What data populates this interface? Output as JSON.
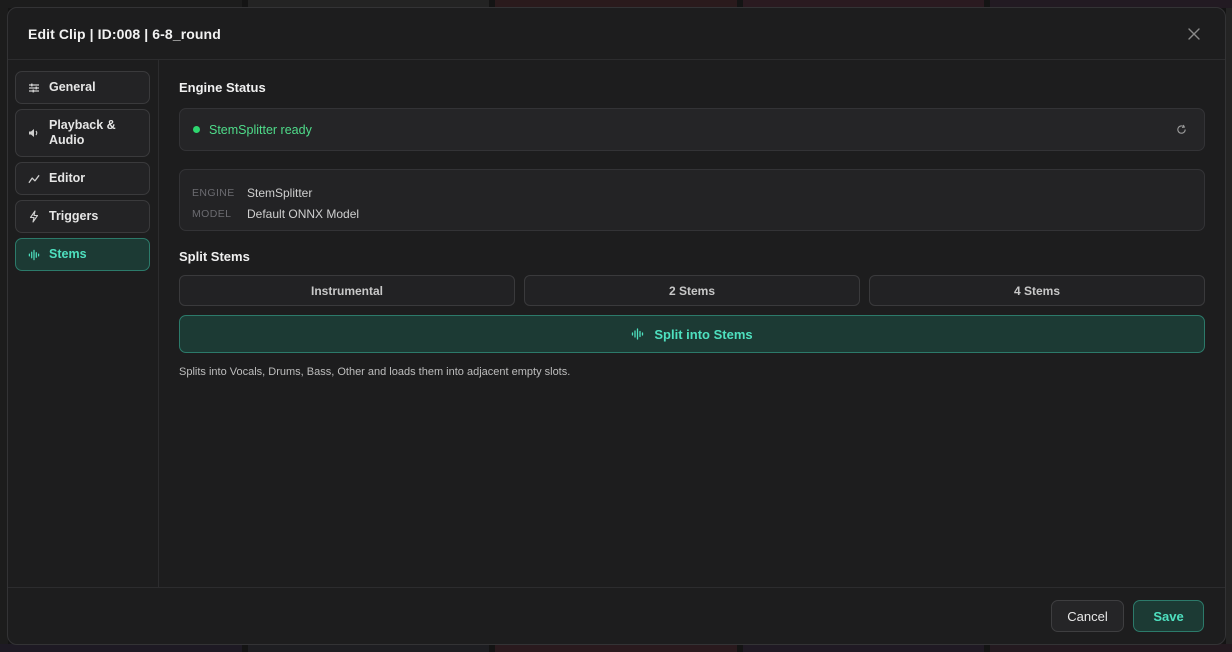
{
  "window": {
    "title": "Edit Clip | ID:008 | 6-8_round",
    "close_icon": "close-icon"
  },
  "sidebar": {
    "items": [
      {
        "label": "General",
        "icon": "sliders-icon",
        "active": false
      },
      {
        "label": "Playback & Audio",
        "icon": "speaker-icon",
        "active": false
      },
      {
        "label": "Editor",
        "icon": "trend-line-icon",
        "active": false
      },
      {
        "label": "Triggers",
        "icon": "lightning-icon",
        "active": false
      },
      {
        "label": "Stems",
        "icon": "waveform-icon",
        "active": true
      }
    ]
  },
  "engine_status": {
    "title": "Engine Status",
    "status_text": "StemSplitter ready",
    "status_color": "#2ed66f",
    "refresh_icon": "refresh-icon",
    "info": [
      {
        "key": "ENGINE",
        "value": "StemSplitter"
      },
      {
        "key": "MODEL",
        "value": "Default ONNX Model"
      }
    ]
  },
  "split_stems": {
    "title": "Split Stems",
    "options": [
      "Instrumental",
      "2 Stems",
      "4 Stems"
    ],
    "action_label": "Split into Stems",
    "action_icon": "waveform-icon",
    "helper": "Splits into Vocals, Drums, Bass, Other and loads them into adjacent empty slots."
  },
  "footer": {
    "cancel_label": "Cancel",
    "save_label": "Save"
  },
  "colors": {
    "accent": "#4ee0bf",
    "accent_bg": "#1c3a34",
    "status_green": "#2ed66f"
  }
}
